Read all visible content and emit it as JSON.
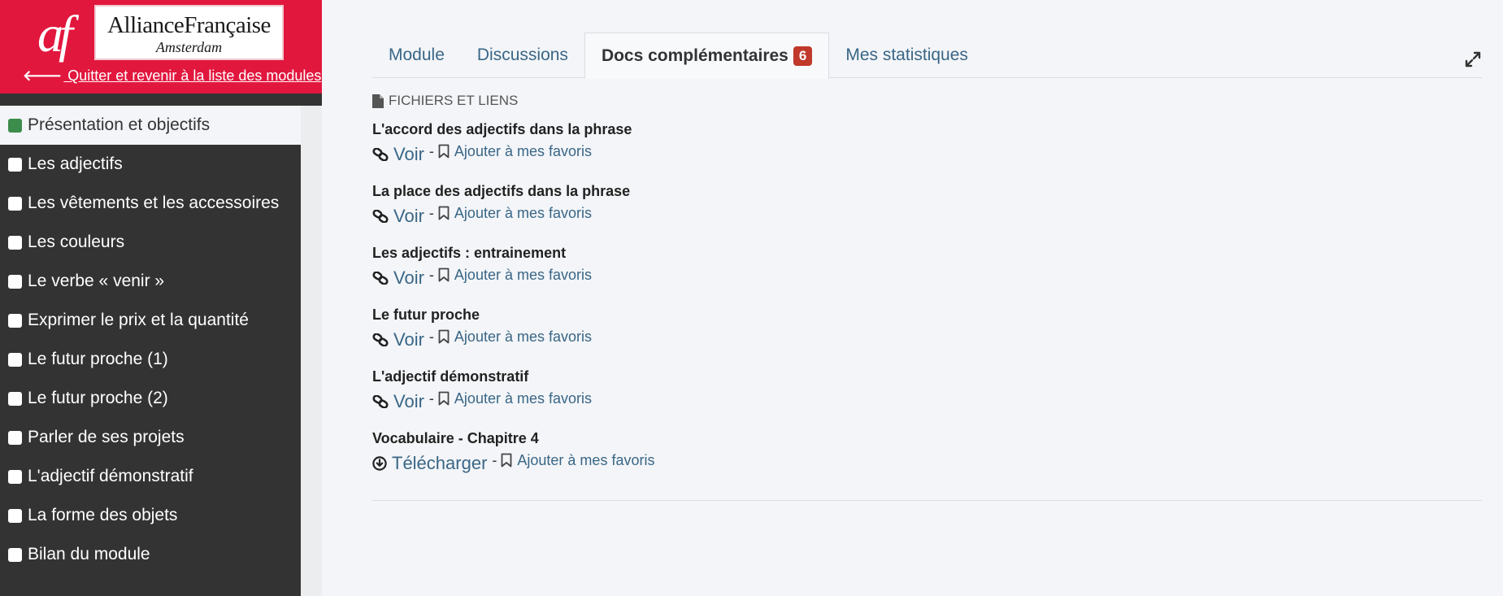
{
  "brand": {
    "mark": "af",
    "logo_main": "AllianceFrançaise",
    "logo_sub": "Amsterdam",
    "quit_link": " Quitter et revenir à la liste des modules"
  },
  "nav": {
    "items": [
      {
        "label": "Présentation et objectifs",
        "active": true
      },
      {
        "label": "Les adjectifs"
      },
      {
        "label": "Les vêtements et les accessoires"
      },
      {
        "label": "Les couleurs"
      },
      {
        "label": "Le verbe « venir »"
      },
      {
        "label": "Exprimer le prix et la quantité"
      },
      {
        "label": "Le futur proche (1)"
      },
      {
        "label": "Le futur proche (2)"
      },
      {
        "label": "Parler de ses projets"
      },
      {
        "label": "L'adjectif démonstratif"
      },
      {
        "label": "La forme des objets"
      },
      {
        "label": "Bilan du module"
      }
    ]
  },
  "tabs": {
    "module": "Module",
    "discussions": "Discussions",
    "docs": "Docs complémentaires",
    "docs_count": "6",
    "stats": "Mes statistiques"
  },
  "section": {
    "title": "FICHIERS ET LIENS"
  },
  "docs": [
    {
      "title": "L'accord des adjectifs dans la phrase",
      "action": "Voir",
      "separator": "-",
      "favorite": "Ajouter à mes favoris"
    },
    {
      "title": "La place des adjectifs dans la phrase",
      "action": "Voir",
      "separator": "-",
      "favorite": "Ajouter à mes favoris"
    },
    {
      "title": "Les adjectifs : entrainement",
      "action": "Voir",
      "separator": "-",
      "favorite": "Ajouter à mes favoris"
    },
    {
      "title": "Le futur proche",
      "action": "Voir",
      "separator": "-",
      "favorite": "Ajouter à mes favoris"
    },
    {
      "title": "L'adjectif démonstratif",
      "action": "Voir",
      "separator": "-",
      "favorite": "Ajouter à mes favoris"
    },
    {
      "title": "Vocabulaire - Chapitre 4",
      "action": "Télécharger",
      "separator": "-",
      "favorite": "Ajouter à mes favoris"
    }
  ],
  "colors": {
    "brand_red": "#e2173e",
    "sidebar_dark": "#333333",
    "link_blue": "#3a6686",
    "badge_red": "#c0392b",
    "progress_green": "#3c8c4c"
  },
  "icons": {
    "quit": "arrow-left-icon",
    "section": "file-icon",
    "view": "link-icon",
    "download": "download-circle-icon",
    "favorite": "bookmark-icon",
    "expand": "expand-icon"
  }
}
